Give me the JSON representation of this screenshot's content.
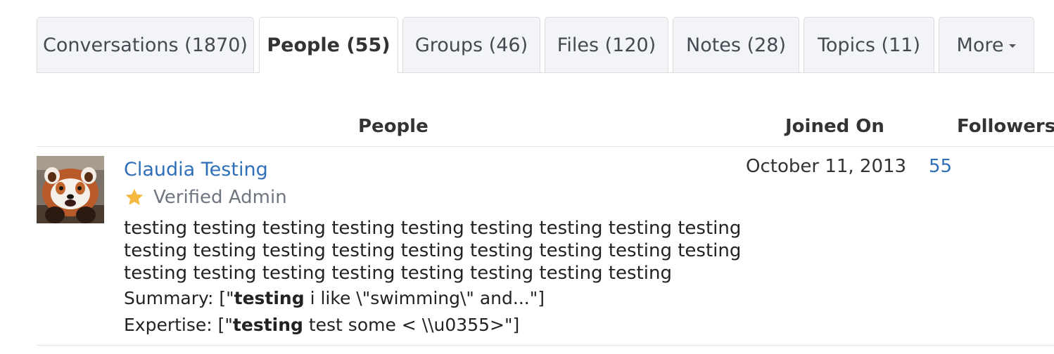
{
  "tabs": [
    {
      "label": "Conversations (1870)"
    },
    {
      "label": "People (55)"
    },
    {
      "label": "Groups (46)"
    },
    {
      "label": "Files (120)"
    },
    {
      "label": "Notes (28)"
    },
    {
      "label": "Topics (11)"
    },
    {
      "label": "More"
    }
  ],
  "active_tab": "People (55)",
  "table": {
    "headers": {
      "people": "People",
      "joined": "Joined On",
      "followers": "Followers"
    }
  },
  "person": {
    "name": "Claudia Testing",
    "badge": "Verified Admin",
    "badge_icon": "star-icon",
    "bio_lines": [
      "testing testing testing testing testing testing testing testing testing",
      "testing testing testing testing testing testing testing testing testing",
      "testing testing testing testing testing testing testing testing"
    ],
    "summary_prefix": "Summary: [\"",
    "summary_match": "testing",
    "summary_rest": " i like \\\"swimming\\\" and...\"]",
    "expertise_prefix": "Expertise: [\"",
    "expertise_match": "testing",
    "expertise_rest": " test some < \\\\u0355>\"]",
    "joined_on": "October 11, 2013",
    "followers": "55"
  },
  "colors": {
    "link": "#2f6fb8",
    "star": "#f5b942",
    "tab_bg": "#f2f4f7"
  }
}
